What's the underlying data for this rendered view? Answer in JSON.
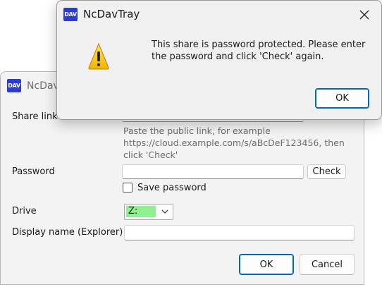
{
  "main_window": {
    "logo_text": "DAV",
    "title": "NcDavTray",
    "share_link": {
      "label": "Share link",
      "value": "",
      "hint": "Paste the public link, for example https://cloud.example.com/s/aBcDeF123456, then click 'Check'"
    },
    "password": {
      "label": "Password",
      "value": "",
      "check_button": "Check",
      "save_password_label": "Save password",
      "save_password_checked": false
    },
    "drive": {
      "label": "Drive",
      "selected": "Z:"
    },
    "display_name": {
      "label": "Display name (Explorer)",
      "value": ""
    },
    "ok_button": "OK",
    "cancel_button": "Cancel"
  },
  "message_box": {
    "logo_text": "DAV",
    "title": "NcDavTray",
    "icon": "warning-icon",
    "message": "This share is password protected. Please enter the password and click 'Check' again.",
    "ok_button": "OK"
  },
  "colors": {
    "accent": "#0067c0",
    "logo": "#2b3bd6",
    "drive_highlight": "#8ff08f",
    "warning_yellow": "#f7c600"
  }
}
